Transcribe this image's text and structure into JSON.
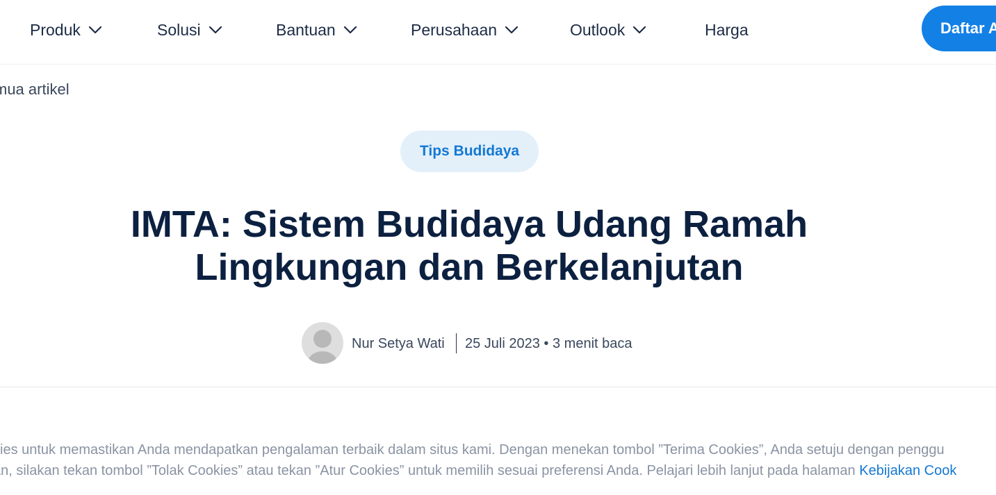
{
  "nav": {
    "items": [
      {
        "label": "Produk"
      },
      {
        "label": "Solusi"
      },
      {
        "label": "Bantuan"
      },
      {
        "label": "Perusahaan"
      },
      {
        "label": "Outlook"
      },
      {
        "label": "Harga"
      }
    ],
    "cta_label": "Daftar A"
  },
  "breadcrumb": {
    "back_label": "mua artikel"
  },
  "article": {
    "category": "Tips Budidaya",
    "title_line1": "IMTA: Sistem Budidaya Udang Ramah",
    "title_line2": "Lingkungan dan Berkelanjutan",
    "author": "Nur Setya Wati",
    "date_read": "25 Juli 2023 • 3 menit baca"
  },
  "cookie_banner": {
    "line1": "kies untuk memastikan Anda mendapatkan pengalaman terbaik dalam situs kami. Dengan menekan tombol ”Terima Cookies”, Anda setuju dengan penggu",
    "line2_prefix": "an, silakan tekan tombol ”Tolak Cookies” atau tekan ”Atur Cookies” untuk memilih sesuai preferensi Anda. Pelajari lebih lanjut pada halaman ",
    "policy_link": "Kebijakan Cook"
  },
  "colors": {
    "accent": "#1380e6",
    "title": "#0c2040",
    "pill_bg": "#e3f0fa"
  }
}
